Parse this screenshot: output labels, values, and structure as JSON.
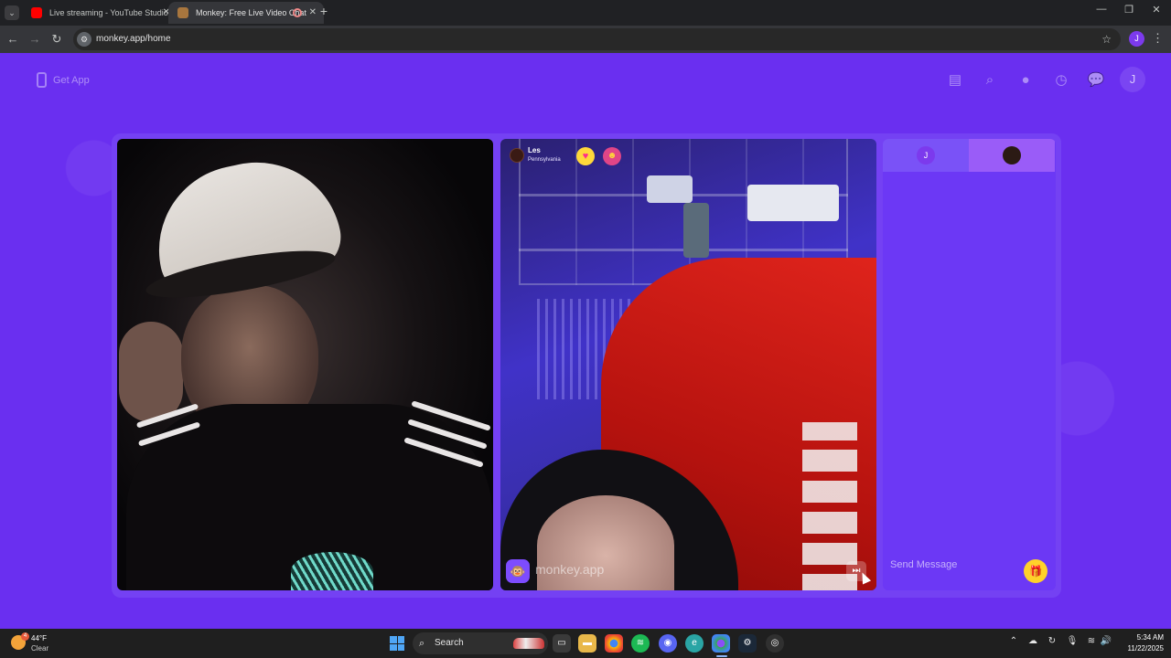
{
  "browser": {
    "tabs": [
      {
        "title": "Live streaming - YouTube Studio",
        "favicon": "youtube-icon",
        "active": false
      },
      {
        "title": "Monkey: Free Live Video Chat",
        "favicon": "monkey-icon",
        "active": true
      }
    ],
    "url": "monkey.app/home"
  },
  "profile_initial": "J",
  "header": {
    "get_app_label": "Get App",
    "icons": [
      "store-icon",
      "search-icon",
      "profile-icon",
      "history-icon",
      "chat-icon"
    ],
    "avatar_initial": "J"
  },
  "peer": {
    "name": "Les",
    "location": "Pennsylvania",
    "badges": [
      "heart-badge",
      "emoji-badge"
    ]
  },
  "watermark": {
    "text": "monkey.app",
    "logo_glyph": "🐵"
  },
  "chat": {
    "me_initial": "J",
    "input_placeholder": "Send Message"
  },
  "taskbar": {
    "weather_temp": "44°F",
    "weather_condition": "Clear",
    "weather_badge": "4",
    "search_label": "Search",
    "time": "5:34 AM",
    "date": "11/22/2025",
    "apps": [
      "task-view-icon",
      "file-explorer-icon",
      "chrome-icon",
      "spotify-icon",
      "discord-icon",
      "edge-icon",
      "chrome-profile-icon",
      "steam-icon",
      "obs-icon"
    ]
  },
  "colors": {
    "page_bg": "#6a2ff0",
    "stage_bg": "#7441f3",
    "accent_gold": "#ffd12a"
  }
}
